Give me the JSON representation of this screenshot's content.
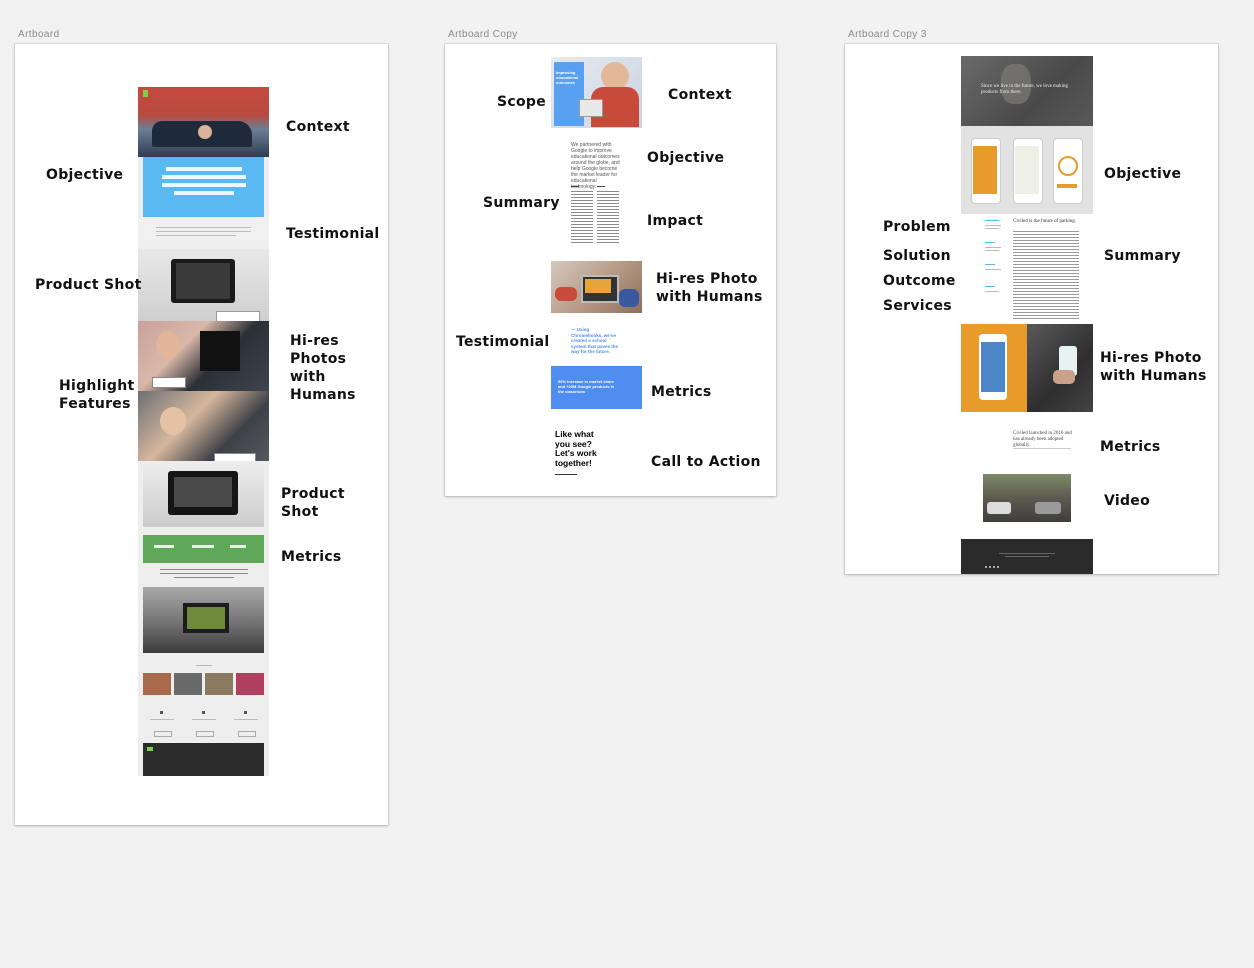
{
  "artboards": [
    {
      "title": "Artboard",
      "labels": [
        "Context",
        "Objective",
        "Testimonial",
        "Product Shot",
        "Hi-res\nPhotos\nwith\nHumans",
        "Highlight\nFeatures",
        "Product\nShot",
        "Metrics"
      ]
    },
    {
      "title": "Artboard Copy",
      "labels": [
        "Scope",
        "Context",
        "Objective",
        "Summary",
        "Impact",
        "Hi-res Photo\nwith Humans",
        "Testimonial",
        "Metrics",
        "Call to Action"
      ],
      "thumb_text": {
        "scope_card": "Improving educational outcomes",
        "summary_para": "We partnered with Google to improve educational outcomes around the globe, and help Google become the market leader for educational technology.",
        "testimonial": "— Using Chromebooks, we've created a school system that paves the way for the future.",
        "metrics": "50% increase in market share and +20M Google products in the classroom",
        "cta": "Like what you see? Let's work together!"
      }
    },
    {
      "title": "Artboard Copy 3",
      "labels": [
        "Objective",
        "Problem",
        "Solution",
        "Outcome",
        "Services",
        "Summary",
        "Hi-res Photo\nwith Humans",
        "Metrics",
        "Video"
      ],
      "thumb_text": {
        "hero": "Since we live in the future, we love making products from there.",
        "summary_title": "Civiled is the future of parking.",
        "metrics_text": "Civiled launched in 2016 and has already been adopted globally."
      }
    }
  ],
  "colors": {
    "canvas": "#f2f2f2",
    "artboard": "#ffffff",
    "blue_card": "#5ab9f0",
    "metrics_blue": "#4f8ef0",
    "green_band": "#5fa85a",
    "orange": "#e89a2a",
    "dark_footer": "#2b2b2b"
  }
}
